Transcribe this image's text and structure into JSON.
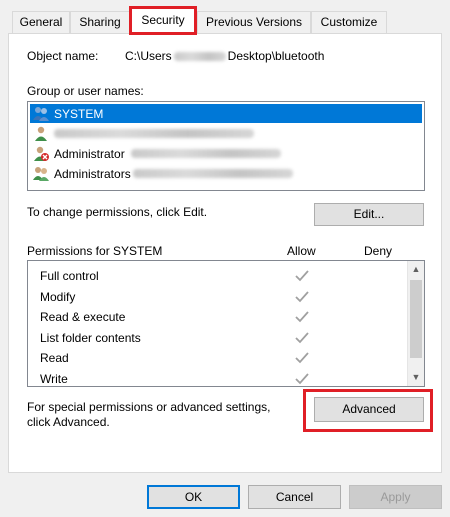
{
  "tabs": [
    {
      "label": "General"
    },
    {
      "label": "Sharing"
    },
    {
      "label": "Security",
      "active": true
    },
    {
      "label": "Previous Versions"
    },
    {
      "label": "Customize"
    }
  ],
  "object": {
    "label": "Object name:",
    "path_prefix": "C:\\Users",
    "path_suffix": "Desktop\\bluetooth"
  },
  "groups": {
    "label": "Group or user names:",
    "items": [
      {
        "name": "SYSTEM",
        "icon": "system-group-icon",
        "selected": true
      },
      {
        "name": "",
        "icon": "user-icon"
      },
      {
        "name": "Administrator",
        "icon": "administrator-user-icon"
      },
      {
        "name": "Administrators",
        "icon": "administrators-group-icon"
      }
    ]
  },
  "change_note": "To change permissions, click Edit.",
  "edit_label": "Edit...",
  "permissions": {
    "header": "Permissions for SYSTEM",
    "allow_label": "Allow",
    "deny_label": "Deny",
    "rows": [
      {
        "name": "Full control",
        "allow": true
      },
      {
        "name": "Modify",
        "allow": true
      },
      {
        "name": "Read & execute",
        "allow": true
      },
      {
        "name": "List folder contents",
        "allow": true
      },
      {
        "name": "Read",
        "allow": true
      },
      {
        "name": "Write",
        "allow": true
      }
    ]
  },
  "special": {
    "line1": "For special permissions or advanced settings,",
    "line2": "click Advanced.",
    "advanced_label": "Advanced"
  },
  "footer": {
    "ok_label": "OK",
    "cancel_label": "Cancel",
    "apply_label": "Apply"
  },
  "colors": {
    "highlight": "#e01f26",
    "selection": "#0078d7",
    "check": "#a0a0a0"
  }
}
